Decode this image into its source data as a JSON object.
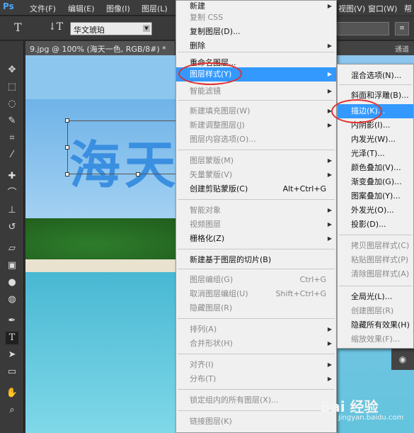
{
  "app": {
    "logo": "Ps"
  },
  "menubar": {
    "file": "文件(F)",
    "edit": "编辑(E)",
    "image": "图像(I)",
    "layer": "图层(L)",
    "view": "视图(V)",
    "window": "窗口(W)",
    "help": "帮"
  },
  "options": {
    "font_name": "华文琥珀"
  },
  "document": {
    "tab_label": "9.jpg @ 100% (海天一色, RGB/8#) *",
    "right_tab": "通道",
    "big_text": "海天"
  },
  "layer_menu": {
    "items": [
      {
        "label": "新建",
        "disabled": false,
        "submenu": true
      },
      {
        "label": "复制 CSS",
        "disabled": true
      },
      {
        "label": "复制图层(D)...",
        "disabled": false
      },
      {
        "label": "删除",
        "disabled": false,
        "submenu": true
      },
      {
        "label": "重命名图层...",
        "disabled": false
      },
      {
        "label": "图层样式(Y)",
        "highlight": true,
        "submenu": true
      },
      {
        "label": "智能滤镜",
        "disabled": true,
        "submenu": true
      },
      {
        "label": "新建填充图层(W)",
        "disabled": true,
        "submenu": true
      },
      {
        "label": "新建调整图层(J)",
        "disabled": true,
        "submenu": true
      },
      {
        "label": "图层内容选项(O)...",
        "disabled": true
      },
      {
        "label": "图层蒙版(M)",
        "disabled": true,
        "submenu": true
      },
      {
        "label": "矢量蒙版(V)",
        "disabled": true,
        "submenu": true
      },
      {
        "label": "创建剪贴蒙版(C)",
        "shortcut": "Alt+Ctrl+G"
      },
      {
        "label": "智能对象",
        "disabled": true,
        "submenu": true
      },
      {
        "label": "视频图层",
        "disabled": true,
        "submenu": true
      },
      {
        "label": "栅格化(Z)",
        "submenu": true
      },
      {
        "label": "新建基于图层的切片(B)"
      },
      {
        "label": "图层编组(G)",
        "shortcut": "Ctrl+G",
        "disabled": true
      },
      {
        "label": "取消图层编组(U)",
        "shortcut": "Shift+Ctrl+G",
        "disabled": true
      },
      {
        "label": "隐藏图层(R)",
        "disabled": true
      },
      {
        "label": "排列(A)",
        "disabled": true,
        "submenu": true
      },
      {
        "label": "合并形状(H)",
        "disabled": true,
        "submenu": true
      },
      {
        "label": "对齐(I)",
        "disabled": true,
        "submenu": true
      },
      {
        "label": "分布(T)",
        "disabled": true,
        "submenu": true
      },
      {
        "label": "锁定组内的所有图层(X)...",
        "disabled": true
      },
      {
        "label": "链接图层(K)",
        "disabled": true
      }
    ]
  },
  "style_menu": {
    "items": [
      {
        "label": "混合选项(N)..."
      },
      {
        "label": "斜面和浮雕(B)..."
      },
      {
        "label": "描边(K)...",
        "highlight": true
      },
      {
        "label": "内阴影(I)..."
      },
      {
        "label": "内发光(W)..."
      },
      {
        "label": "光泽(T)..."
      },
      {
        "label": "颜色叠加(V)..."
      },
      {
        "label": "渐变叠加(G)..."
      },
      {
        "label": "图案叠加(Y)..."
      },
      {
        "label": "外发光(O)..."
      },
      {
        "label": "投影(D)..."
      },
      {
        "label": "拷贝图层样式(C)",
        "disabled": true
      },
      {
        "label": "粘贴图层样式(P)",
        "disabled": true
      },
      {
        "label": "清除图层样式(A)",
        "disabled": true
      },
      {
        "label": "全局光(L)..."
      },
      {
        "label": "创建图层(R)",
        "disabled": true
      },
      {
        "label": "隐藏所有效果(H)"
      },
      {
        "label": "缩放效果(F)...",
        "disabled": true
      }
    ]
  },
  "watermark": {
    "text": "Bai 经验",
    "sub": "jingyan.baidu.com"
  },
  "colors": {
    "highlight": "#3399ff",
    "annotation_ring": "#e03030"
  }
}
